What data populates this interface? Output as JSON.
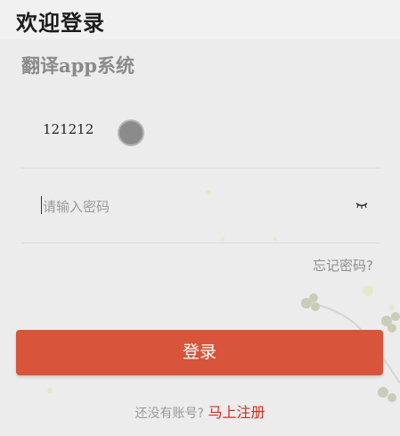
{
  "header": {
    "welcome": "欢迎登录"
  },
  "app": {
    "subtitle": "翻译app系统"
  },
  "form": {
    "username_value": "121212",
    "password_placeholder": "请输入密码",
    "forgot_label": "忘记密码?",
    "login_label": "登录"
  },
  "footer": {
    "question": "还没有账号?",
    "register_link": "马上注册"
  },
  "colors": {
    "accent": "#d8543a",
    "link": "#d52b1e",
    "background": "#ececec"
  },
  "icons": {
    "password_toggle": "eye-closed-icon"
  }
}
